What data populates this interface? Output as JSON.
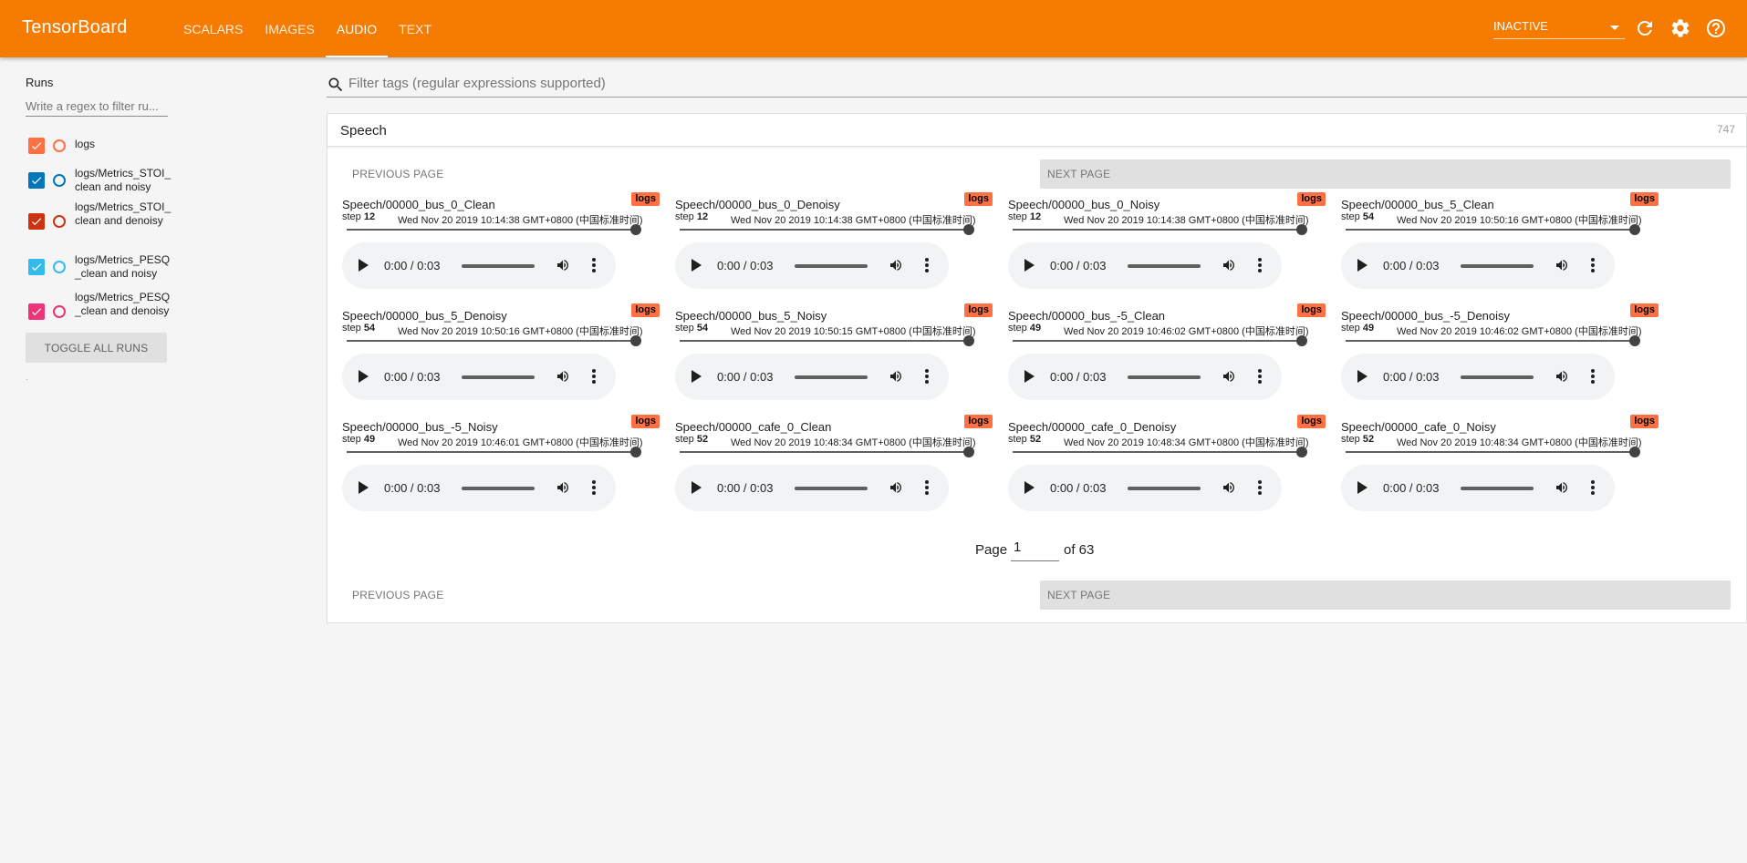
{
  "app": {
    "brand": "TensorBoard"
  },
  "nav": {
    "tabs": [
      {
        "label": "SCALARS"
      },
      {
        "label": "IMAGES"
      },
      {
        "label": "AUDIO"
      },
      {
        "label": "TEXT"
      }
    ],
    "active_tab": "AUDIO",
    "status_select": {
      "value": "INACTIVE"
    },
    "icons": [
      "refresh-icon",
      "settings-icon",
      "help-icon"
    ]
  },
  "sidebar": {
    "title": "Runs",
    "filter_placeholder": "Write a regex to filter ru...",
    "runs": [
      {
        "label": "logs",
        "checked": true,
        "color": "#ff7043"
      },
      {
        "label": "logs/Metrics_STOI_clean and noisy",
        "checked": true,
        "color": "#0077bb"
      },
      {
        "label": "logs/Metrics_STOI_clean and denoisy",
        "checked": true,
        "color": "#cc3311"
      },
      {
        "label": "logs/Metrics_PESQ_clean and noisy",
        "checked": true,
        "color": "#33bbee"
      },
      {
        "label": "logs/Metrics_PESQ_clean and denoisy",
        "checked": true,
        "color": "#ee3377"
      }
    ],
    "toggle_label": "TOGGLE ALL RUNS",
    "tiny_text": "."
  },
  "main": {
    "tag_filter_placeholder": "Filter tags (regular expressions supported)",
    "pane": {
      "title": "Speech",
      "count": "747",
      "prev_label": "PREVIOUS PAGE",
      "next_label": "NEXT PAGE",
      "page_label": "Page",
      "page_value": "1",
      "page_of": "of 63",
      "step_prefix": "step",
      "cards": [
        {
          "title": "Speech/00000_bus_0_Clean",
          "run": "logs",
          "step": "12",
          "time": "Wed Nov 20 2019 10:14:38 GMT+0800 (中国标准时间)",
          "audio_time": "0:00 / 0:03"
        },
        {
          "title": "Speech/00000_bus_0_Denoisy",
          "run": "logs",
          "step": "12",
          "time": "Wed Nov 20 2019 10:14:38 GMT+0800 (中国标准时间)",
          "audio_time": "0:00 / 0:03"
        },
        {
          "title": "Speech/00000_bus_0_Noisy",
          "run": "logs",
          "step": "12",
          "time": "Wed Nov 20 2019 10:14:38 GMT+0800 (中国标准时间)",
          "audio_time": "0:00 / 0:03"
        },
        {
          "title": "Speech/00000_bus_5_Clean",
          "run": "logs",
          "step": "54",
          "time": "Wed Nov 20 2019 10:50:16 GMT+0800 (中国标准时间)",
          "audio_time": "0:00 / 0:03"
        },
        {
          "title": "Speech/00000_bus_5_Denoisy",
          "run": "logs",
          "step": "54",
          "time": "Wed Nov 20 2019 10:50:16 GMT+0800 (中国标准时间)",
          "audio_time": "0:00 / 0:03"
        },
        {
          "title": "Speech/00000_bus_5_Noisy",
          "run": "logs",
          "step": "54",
          "time": "Wed Nov 20 2019 10:50:15 GMT+0800 (中国标准时间)",
          "audio_time": "0:00 / 0:03"
        },
        {
          "title": "Speech/00000_bus_-5_Clean",
          "run": "logs",
          "step": "49",
          "time": "Wed Nov 20 2019 10:46:02 GMT+0800 (中国标准时间)",
          "audio_time": "0:00 / 0:03"
        },
        {
          "title": "Speech/00000_bus_-5_Denoisy",
          "run": "logs",
          "step": "49",
          "time": "Wed Nov 20 2019 10:46:02 GMT+0800 (中国标准时间)",
          "audio_time": "0:00 / 0:03"
        },
        {
          "title": "Speech/00000_bus_-5_Noisy",
          "run": "logs",
          "step": "49",
          "time": "Wed Nov 20 2019 10:46:01 GMT+0800 (中国标准时间)",
          "audio_time": "0:00 / 0:03"
        },
        {
          "title": "Speech/00000_cafe_0_Clean",
          "run": "logs",
          "step": "52",
          "time": "Wed Nov 20 2019 10:48:34 GMT+0800 (中国标准时间)",
          "audio_time": "0:00 / 0:03"
        },
        {
          "title": "Speech/00000_cafe_0_Denoisy",
          "run": "logs",
          "step": "52",
          "time": "Wed Nov 20 2019 10:48:34 GMT+0800 (中国标准时间)",
          "audio_time": "0:00 / 0:03"
        },
        {
          "title": "Speech/00000_cafe_0_Noisy",
          "run": "logs",
          "step": "52",
          "time": "Wed Nov 20 2019 10:48:34 GMT+0800 (中国标准时间)",
          "audio_time": "0:00 / 0:03"
        }
      ]
    }
  },
  "colors": {
    "header": "#f57c00",
    "badge": "#ff7043"
  }
}
